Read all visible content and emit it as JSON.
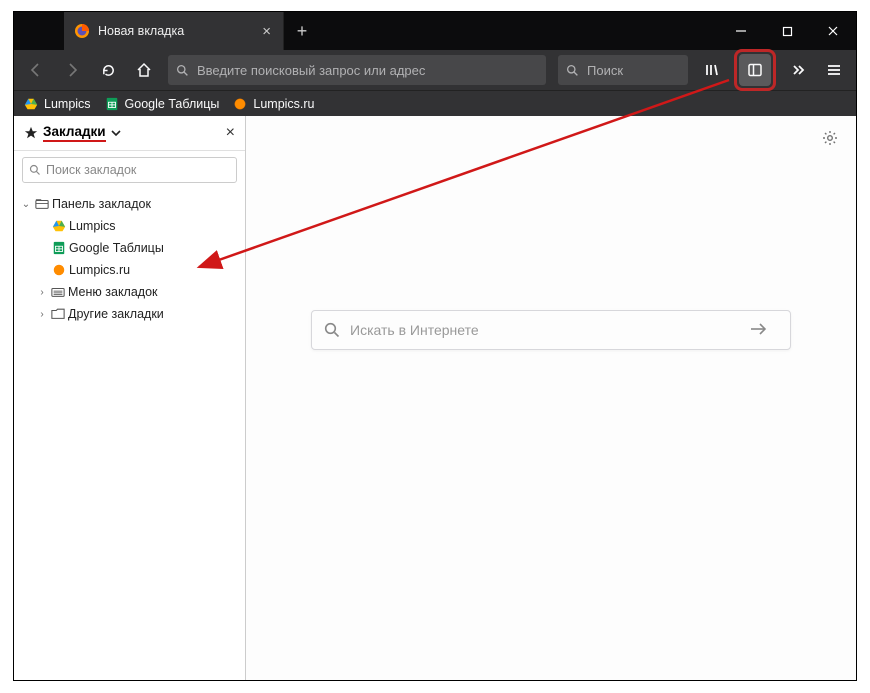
{
  "tab": {
    "title": "Новая вкладка"
  },
  "urlbar": {
    "placeholder": "Введите поисковый запрос или адрес"
  },
  "searchbar": {
    "placeholder": "Поиск"
  },
  "bookmarks_bar": [
    {
      "label": "Lumpics",
      "icon": "drive"
    },
    {
      "label": "Google Таблицы",
      "icon": "sheets"
    },
    {
      "label": "Lumpics.ru",
      "icon": "orange"
    }
  ],
  "sidebar": {
    "title": "Закладки",
    "search_placeholder": "Поиск закладок",
    "tree": {
      "toolbar": {
        "label": "Панель закладок",
        "items": [
          {
            "label": "Lumpics",
            "icon": "drive"
          },
          {
            "label": "Google Таблицы",
            "icon": "sheets"
          },
          {
            "label": "Lumpics.ru",
            "icon": "orange"
          }
        ]
      },
      "menu": {
        "label": "Меню закладок"
      },
      "other": {
        "label": "Другие закладки"
      }
    }
  },
  "newtab": {
    "search_placeholder": "Искать в Интернете"
  }
}
